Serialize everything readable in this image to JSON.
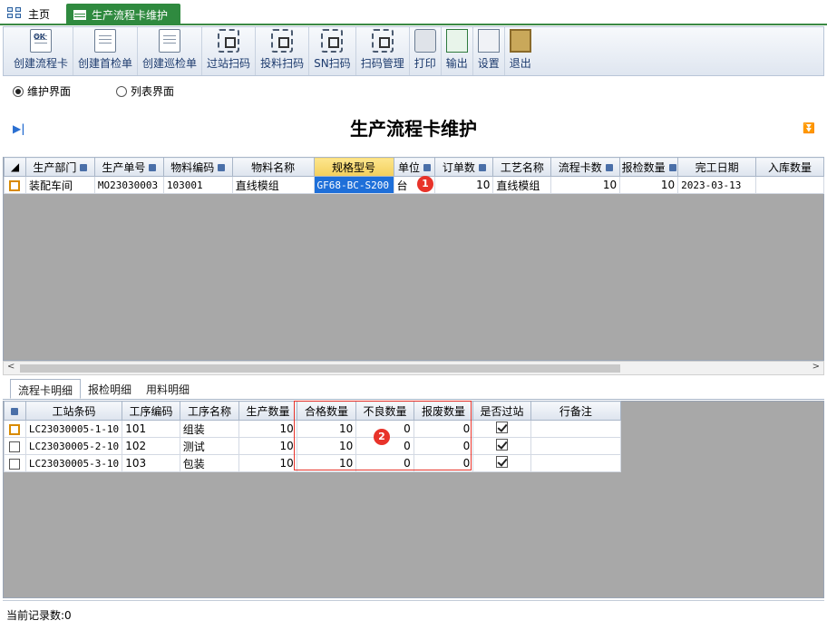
{
  "tabs": {
    "home": "主页",
    "active": "生产流程卡维护"
  },
  "toolbar": [
    {
      "label": "创建流程卡",
      "icon": "ok-doc-icon"
    },
    {
      "label": "创建首检单",
      "icon": "doc-search-icon"
    },
    {
      "label": "创建巡检单",
      "icon": "doc-search-icon"
    },
    {
      "label": "过站扫码",
      "icon": "scan-icon"
    },
    {
      "label": "投料扫码",
      "icon": "scan-icon"
    },
    {
      "label": "SN扫码",
      "icon": "scan-icon"
    },
    {
      "label": "扫码管理",
      "icon": "scan-doc-icon"
    },
    {
      "label": "打印",
      "icon": "printer-icon"
    },
    {
      "label": "输出",
      "icon": "export-icon"
    },
    {
      "label": "设置",
      "icon": "settings-icon"
    },
    {
      "label": "退出",
      "icon": "exit-icon"
    }
  ],
  "view_mode": {
    "option_maintain": "维护界面",
    "option_list": "列表界面",
    "selected": "维护界面"
  },
  "page_title": "生产流程卡维护",
  "main_grid": {
    "columns": [
      "生产部门",
      "生产单号",
      "物料编码",
      "物料名称",
      "规格型号",
      "单位",
      "订单数",
      "工艺名称",
      "流程卡数",
      "报检数量",
      "完工日期",
      "入库数量"
    ],
    "rows": [
      {
        "dept": "装配车间",
        "order_no": "MO23030003",
        "material_code": "103001",
        "material_name": "直线模组",
        "spec": "GF68-BC-S200",
        "unit": "台",
        "order_qty": "10",
        "process_name": "直线模组",
        "card_qty": "10",
        "inspect_qty": "10",
        "finish_date": "2023-03-13",
        "stock_qty": ""
      }
    ]
  },
  "sub_tabs": [
    "流程卡明细",
    "报检明细",
    "用料明细"
  ],
  "detail_grid": {
    "columns": [
      "工站条码",
      "工序编码",
      "工序名称",
      "生产数量",
      "合格数量",
      "不良数量",
      "报废数量",
      "是否过站",
      "行备注"
    ],
    "rows": [
      {
        "barcode": "LC23030005-1-10",
        "op_code": "101",
        "op_name": "组装",
        "prod_qty": "10",
        "pass_qty": "10",
        "defect_qty": "0",
        "scrap_qty": "0",
        "passed": true,
        "remark": ""
      },
      {
        "barcode": "LC23030005-2-10",
        "op_code": "102",
        "op_name": "测试",
        "prod_qty": "10",
        "pass_qty": "10",
        "defect_qty": "0",
        "scrap_qty": "0",
        "passed": true,
        "remark": ""
      },
      {
        "barcode": "LC23030005-3-10",
        "op_code": "103",
        "op_name": "包装",
        "prod_qty": "10",
        "pass_qty": "10",
        "defect_qty": "0",
        "scrap_qty": "0",
        "passed": true,
        "remark": ""
      }
    ]
  },
  "annotations": {
    "badge1": "1",
    "badge2": "2"
  },
  "status": "当前记录数:0",
  "colors": {
    "accent": "#2f8a3f",
    "header_highlight": "#f7d774",
    "selection": "#1e6fd9",
    "badge": "#e8332a"
  }
}
